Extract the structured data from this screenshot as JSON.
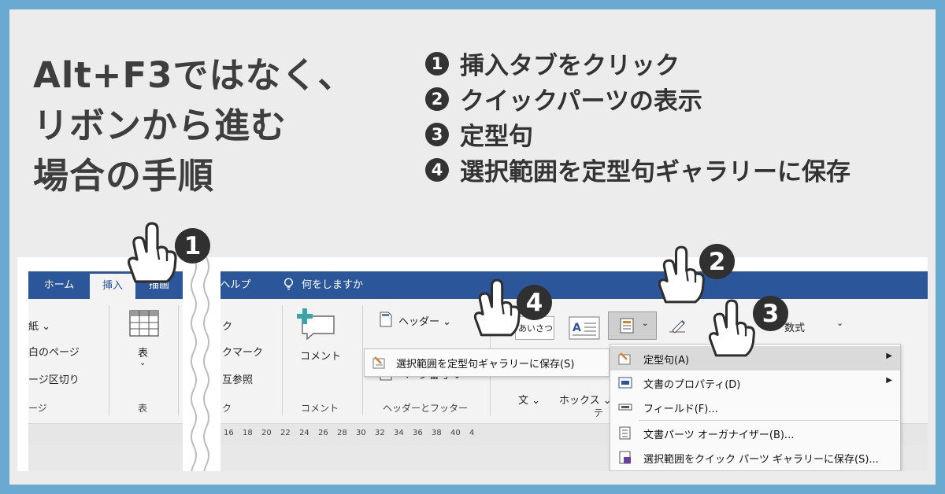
{
  "headline": {
    "line1": "Alt+F3ではなく、",
    "line2": "リボンから進む",
    "line3": "場合の手順"
  },
  "steps": [
    {
      "num": "1",
      "text": "挿入タブをクリック"
    },
    {
      "num": "2",
      "text": "クイックパーツの表示"
    },
    {
      "num": "3",
      "text": "定型句"
    },
    {
      "num": "4",
      "text": "選択範囲を定型句ギャラリーに保存"
    }
  ],
  "word": {
    "tabs": {
      "home": "ホーム",
      "insert": "挿入",
      "draw": "描画",
      "help": "ヘルプ"
    },
    "tell_me": "何をしますか",
    "pages_group": {
      "item1": "紙 ⌄",
      "item2": "白のページ",
      "item3": "ージ区切り",
      "label": "ージ"
    },
    "table_group": {
      "button": "表",
      "caret": "⌄",
      "label": "表"
    },
    "links_group": {
      "item1": "ク",
      "item2": "クマーク",
      "item3": "互参照",
      "label": "ク"
    },
    "comment_group": {
      "button": "コメント",
      "label": "コメント"
    },
    "header_group": {
      "header": "ヘッダー ⌄",
      "page_number": "ページ番号 ⌄",
      "label": "ヘッダーとフッター"
    },
    "text_group": {
      "aisatsu": "あいさつ",
      "textbox_frag": "文 ⌄",
      "box_frag": "ホックス ⌄",
      "label_frag": "テ"
    },
    "equation_frag": "数式",
    "equation_caret": "⌄",
    "ruler_numbers": [
      "16",
      "18",
      "20",
      "22",
      "24",
      "26",
      "28",
      "30",
      "32",
      "34",
      "36",
      "38",
      "40",
      "4"
    ],
    "left_popup": {
      "save_selection": "選択範囲を定型句ギャラリーに保存(S)"
    },
    "quick_parts_menu": [
      {
        "label": "定型句(A)",
        "arrow": "▶",
        "icon": "autotext-icon"
      },
      {
        "label": "文書のプロパティ(D)",
        "arrow": "▶",
        "icon": "document-property-icon"
      },
      {
        "label": "フィールド(F)...",
        "arrow": "",
        "icon": "field-icon"
      },
      {
        "label": "文書パーツ オーガナイザー(B)...",
        "arrow": "",
        "icon": "building-blocks-organizer-icon"
      },
      {
        "label": "選択範囲をクイック パーツ ギャラリーに保存(S)...",
        "arrow": "",
        "icon": "save-to-gallery-icon"
      }
    ]
  },
  "callouts": {
    "c1": "1",
    "c2": "2",
    "c3": "3",
    "c4": "4"
  },
  "colors": {
    "frame": "#6aaad0",
    "background": "#ececec",
    "word_accent": "#2b579a",
    "callout": "#303030",
    "text_dark": "#3e3e3e"
  }
}
